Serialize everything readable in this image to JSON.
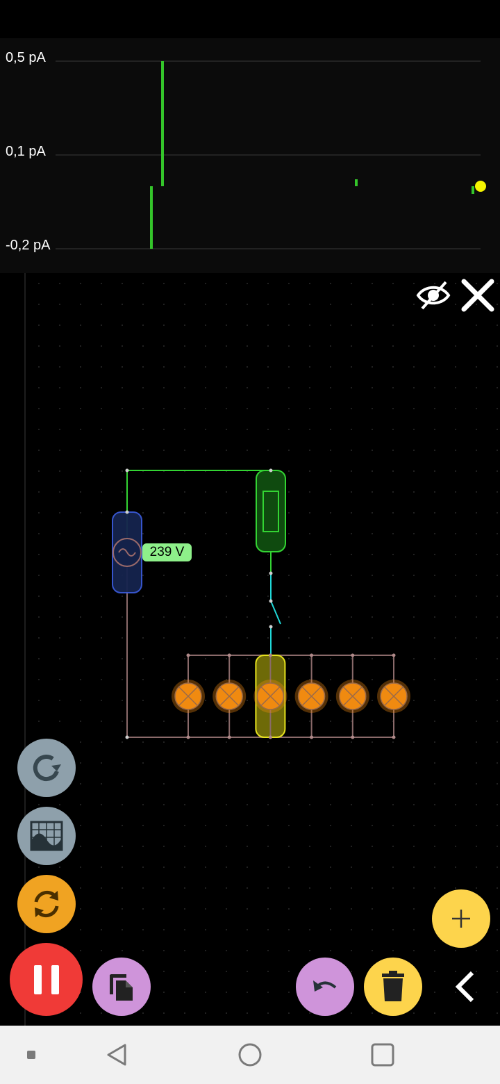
{
  "graph": {
    "y_labels": [
      "0,5 pA",
      "0,1 pA",
      "-0,2 pA"
    ],
    "trace_color": "#7fe020",
    "cursor_color": "#f5f500"
  },
  "graph_controls": {
    "hide_icon": "eye-off-icon",
    "close_icon": "close-icon"
  },
  "circuit": {
    "source_voltage": "239 V",
    "lamp_count": 6,
    "source_color": "#2a3f8f",
    "fuse_color": "#1c8a1c",
    "lamp_color": "#f08a10",
    "selected_color": "#e6e21e"
  },
  "sidebar_buttons": [
    {
      "name": "rotate-button",
      "icon": "rotate-icon",
      "color": "#8ea0ab"
    },
    {
      "name": "oscilloscope-button",
      "icon": "oscilloscope-icon",
      "color": "#8ea0ab"
    },
    {
      "name": "reset-simulation-button",
      "icon": "sync-icon",
      "color": "#f0a322"
    }
  ],
  "bottom_toolbar": {
    "pause_color": "#f03a37",
    "copy_color": "#cf94da",
    "undo_color": "#cf94da",
    "delete_color": "#fdd44c",
    "add_color": "#fdd44c"
  },
  "system_nav": {
    "back_icon": "back-icon",
    "home_icon": "home-icon",
    "recents_icon": "recents-icon"
  }
}
